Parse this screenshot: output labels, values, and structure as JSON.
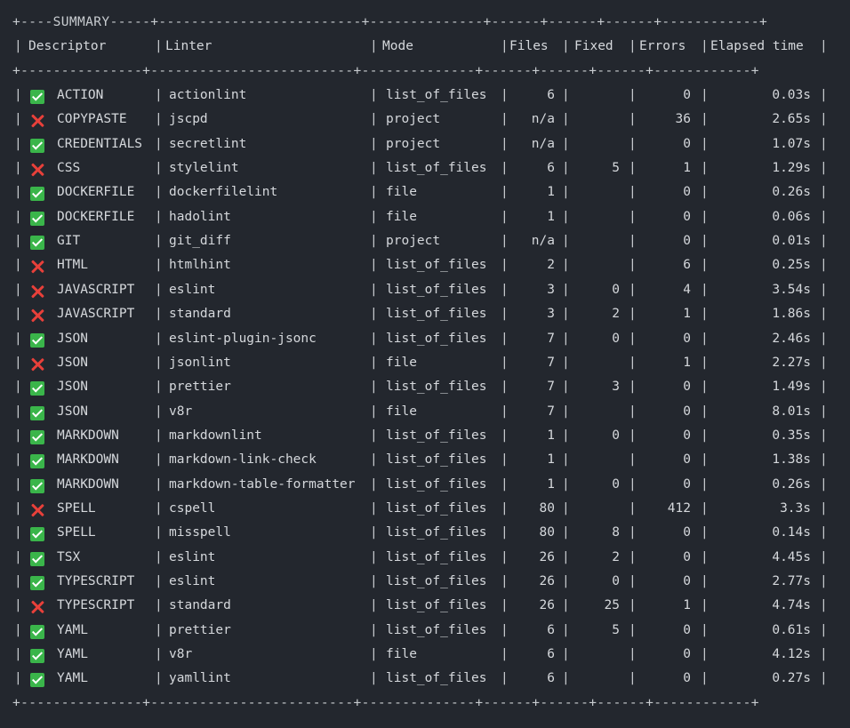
{
  "summary_title": "SUMMARY",
  "headers": {
    "descriptor": "Descriptor",
    "linter": "Linter",
    "mode": "Mode",
    "files": "Files",
    "fixed": "Fixed",
    "errors": "Errors",
    "elapsed": "Elapsed time"
  },
  "colors": {
    "background": "#23272e",
    "success": "#3ab54a",
    "error": "#e8403a"
  },
  "rows": [
    {
      "status": "success",
      "descriptor": "ACTION",
      "linter": "actionlint",
      "mode": "list_of_files",
      "files": "6",
      "fixed": "",
      "errors": "0",
      "elapsed": "0.03s"
    },
    {
      "status": "error",
      "descriptor": "COPYPASTE",
      "linter": "jscpd",
      "mode": "project",
      "files": "n/a",
      "fixed": "",
      "errors": "36",
      "elapsed": "2.65s"
    },
    {
      "status": "success",
      "descriptor": "CREDENTIALS",
      "linter": "secretlint",
      "mode": "project",
      "files": "n/a",
      "fixed": "",
      "errors": "0",
      "elapsed": "1.07s"
    },
    {
      "status": "error",
      "descriptor": "CSS",
      "linter": "stylelint",
      "mode": "list_of_files",
      "files": "6",
      "fixed": "5",
      "errors": "1",
      "elapsed": "1.29s"
    },
    {
      "status": "success",
      "descriptor": "DOCKERFILE",
      "linter": "dockerfilelint",
      "mode": "file",
      "files": "1",
      "fixed": "",
      "errors": "0",
      "elapsed": "0.26s"
    },
    {
      "status": "success",
      "descriptor": "DOCKERFILE",
      "linter": "hadolint",
      "mode": "file",
      "files": "1",
      "fixed": "",
      "errors": "0",
      "elapsed": "0.06s"
    },
    {
      "status": "success",
      "descriptor": "GIT",
      "linter": "git_diff",
      "mode": "project",
      "files": "n/a",
      "fixed": "",
      "errors": "0",
      "elapsed": "0.01s"
    },
    {
      "status": "error",
      "descriptor": "HTML",
      "linter": "htmlhint",
      "mode": "list_of_files",
      "files": "2",
      "fixed": "",
      "errors": "6",
      "elapsed": "0.25s"
    },
    {
      "status": "error",
      "descriptor": "JAVASCRIPT",
      "linter": "eslint",
      "mode": "list_of_files",
      "files": "3",
      "fixed": "0",
      "errors": "4",
      "elapsed": "3.54s"
    },
    {
      "status": "error",
      "descriptor": "JAVASCRIPT",
      "linter": "standard",
      "mode": "list_of_files",
      "files": "3",
      "fixed": "2",
      "errors": "1",
      "elapsed": "1.86s"
    },
    {
      "status": "success",
      "descriptor": "JSON",
      "linter": "eslint-plugin-jsonc",
      "mode": "list_of_files",
      "files": "7",
      "fixed": "0",
      "errors": "0",
      "elapsed": "2.46s"
    },
    {
      "status": "error",
      "descriptor": "JSON",
      "linter": "jsonlint",
      "mode": "file",
      "files": "7",
      "fixed": "",
      "errors": "1",
      "elapsed": "2.27s"
    },
    {
      "status": "success",
      "descriptor": "JSON",
      "linter": "prettier",
      "mode": "list_of_files",
      "files": "7",
      "fixed": "3",
      "errors": "0",
      "elapsed": "1.49s"
    },
    {
      "status": "success",
      "descriptor": "JSON",
      "linter": "v8r",
      "mode": "file",
      "files": "7",
      "fixed": "",
      "errors": "0",
      "elapsed": "8.01s"
    },
    {
      "status": "success",
      "descriptor": "MARKDOWN",
      "linter": "markdownlint",
      "mode": "list_of_files",
      "files": "1",
      "fixed": "0",
      "errors": "0",
      "elapsed": "0.35s"
    },
    {
      "status": "success",
      "descriptor": "MARKDOWN",
      "linter": "markdown-link-check",
      "mode": "list_of_files",
      "files": "1",
      "fixed": "",
      "errors": "0",
      "elapsed": "1.38s"
    },
    {
      "status": "success",
      "descriptor": "MARKDOWN",
      "linter": "markdown-table-formatter",
      "mode": "list_of_files",
      "files": "1",
      "fixed": "0",
      "errors": "0",
      "elapsed": "0.26s"
    },
    {
      "status": "error",
      "descriptor": "SPELL",
      "linter": "cspell",
      "mode": "list_of_files",
      "files": "80",
      "fixed": "",
      "errors": "412",
      "elapsed": "3.3s"
    },
    {
      "status": "success",
      "descriptor": "SPELL",
      "linter": "misspell",
      "mode": "list_of_files",
      "files": "80",
      "fixed": "8",
      "errors": "0",
      "elapsed": "0.14s"
    },
    {
      "status": "success",
      "descriptor": "TSX",
      "linter": "eslint",
      "mode": "list_of_files",
      "files": "26",
      "fixed": "2",
      "errors": "0",
      "elapsed": "4.45s"
    },
    {
      "status": "success",
      "descriptor": "TYPESCRIPT",
      "linter": "eslint",
      "mode": "list_of_files",
      "files": "26",
      "fixed": "0",
      "errors": "0",
      "elapsed": "2.77s"
    },
    {
      "status": "error",
      "descriptor": "TYPESCRIPT",
      "linter": "standard",
      "mode": "list_of_files",
      "files": "26",
      "fixed": "25",
      "errors": "1",
      "elapsed": "4.74s"
    },
    {
      "status": "success",
      "descriptor": "YAML",
      "linter": "prettier",
      "mode": "list_of_files",
      "files": "6",
      "fixed": "5",
      "errors": "0",
      "elapsed": "0.61s"
    },
    {
      "status": "success",
      "descriptor": "YAML",
      "linter": "v8r",
      "mode": "file",
      "files": "6",
      "fixed": "",
      "errors": "0",
      "elapsed": "4.12s"
    },
    {
      "status": "success",
      "descriptor": "YAML",
      "linter": "yamllint",
      "mode": "list_of_files",
      "files": "6",
      "fixed": "",
      "errors": "0",
      "elapsed": "0.27s"
    }
  ]
}
